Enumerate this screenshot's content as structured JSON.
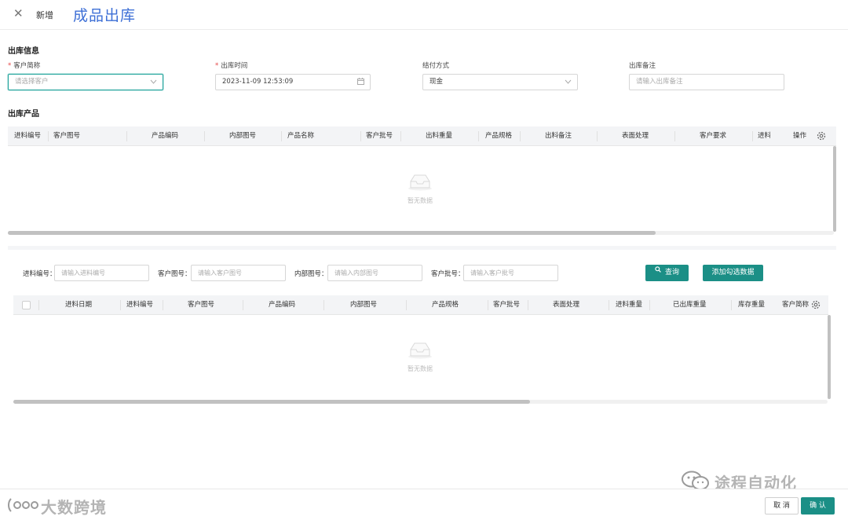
{
  "header": {
    "close_glyph": "✕",
    "mode_label": "新增",
    "title": "成品出库"
  },
  "outbound_info": {
    "section_title": "出库信息",
    "customer": {
      "label": "客户简称",
      "required": true,
      "placeholder": "请选择客户"
    },
    "outbound_time": {
      "label": "出库时间",
      "required": true,
      "value": "2023-11-09 12:53:09"
    },
    "payment_method": {
      "label": "结付方式",
      "value": "现金"
    },
    "remark": {
      "label": "出库备注",
      "placeholder": "请输入出库备注"
    }
  },
  "outbound_products": {
    "section_title": "出库产品",
    "columns": [
      "进料编号",
      "客户图号",
      "产品编码",
      "内部图号",
      "产品名称",
      "客户批号",
      "出料重量",
      "产品规格",
      "出料备注",
      "表面处理",
      "客户要求",
      "进料",
      "操作"
    ],
    "empty_text": "暂无数据"
  },
  "search": {
    "incoming_no": {
      "label": "进料编号：",
      "placeholder": "请输入进料编号"
    },
    "customer_drawing_no": {
      "label": "客户图号：",
      "placeholder": "请输入客户图号"
    },
    "internal_drawing_no": {
      "label": "内部图号：",
      "placeholder": "请输入内部图号"
    },
    "customer_batch_no": {
      "label": "客户批号：",
      "placeholder": "请输入客户批号"
    },
    "query_button": "查询",
    "add_selected_button": "添加勾选数据"
  },
  "selection_table": {
    "columns": [
      "进料日期",
      "进料编号",
      "客户图号",
      "产品编码",
      "内部图号",
      "产品规格",
      "客户批号",
      "表面处理",
      "进料重量",
      "已出库重量",
      "库存重量",
      "客户简称"
    ],
    "empty_text": "暂无数据"
  },
  "footer": {
    "cancel_button": "取 消",
    "confirm_button": "确 认"
  },
  "watermarks": {
    "wechat": "途程自动化",
    "brand": "大数跨境"
  },
  "icons": {
    "close": "close-icon",
    "dropdown": "chevron-down-icon",
    "calendar": "calendar-icon",
    "settings": "gear-icon",
    "search": "search-icon",
    "empty": "empty-box-icon"
  },
  "colors": {
    "accent": "#1b8f86",
    "title_blue": "#3d6fd6",
    "required": "#e54545"
  }
}
